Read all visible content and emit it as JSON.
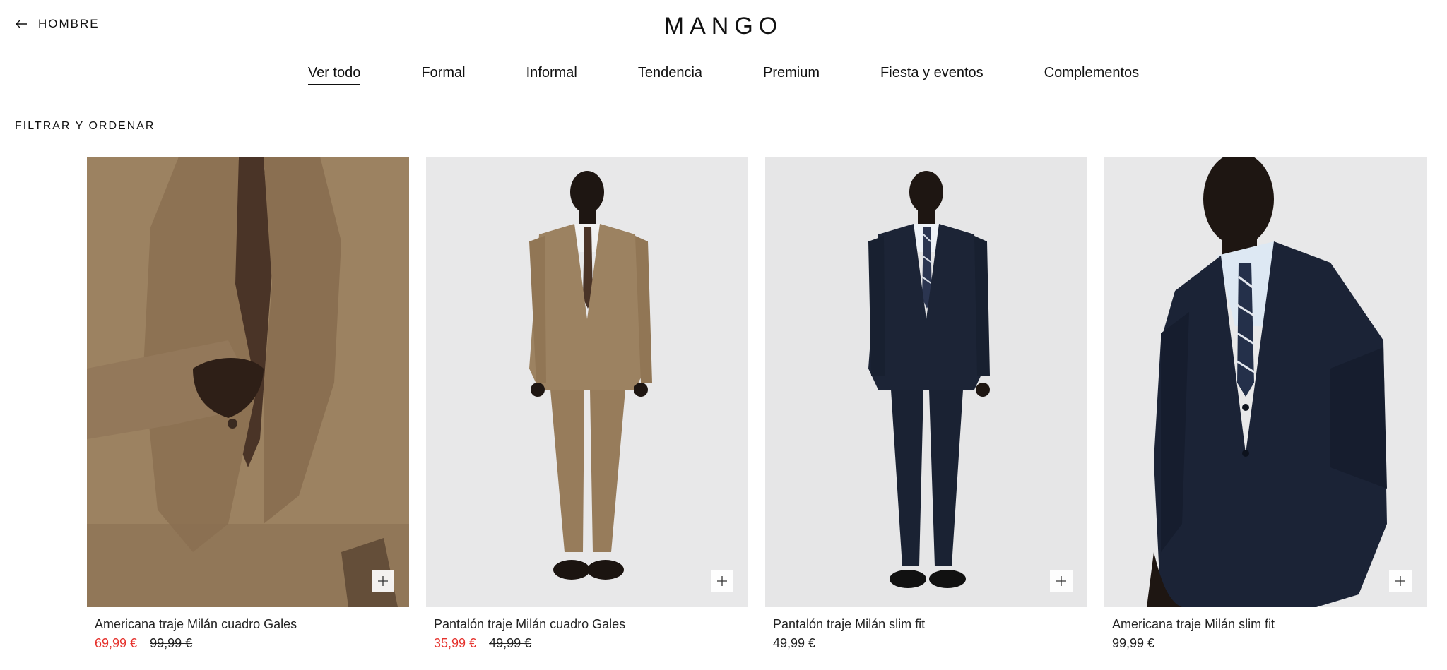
{
  "header": {
    "back_label": "HOMBRE",
    "logo": "MANGO"
  },
  "nav": {
    "items": [
      {
        "label": "Ver todo",
        "active": true
      },
      {
        "label": "Formal"
      },
      {
        "label": "Informal"
      },
      {
        "label": "Tendencia"
      },
      {
        "label": "Premium"
      },
      {
        "label": "Fiesta y eventos"
      },
      {
        "label": "Complementos"
      }
    ]
  },
  "filter_label": "FILTRAR Y ORDENAR",
  "products": [
    {
      "name": "Americana traje Milán cuadro Gales",
      "price": "69,99 €",
      "old_price": "99,99 €",
      "image": "brown-suit-closeup"
    },
    {
      "name": "Pantalón traje Milán cuadro Gales",
      "price": "35,99 €",
      "old_price": "49,99 €",
      "image": "brown-suit-full"
    },
    {
      "name": "Pantalón traje Milán slim fit",
      "price": "49,99 €",
      "image": "navy-suit-full"
    },
    {
      "name": "Americana traje Milán slim fit",
      "price": "99,99 €",
      "image": "navy-suit-half"
    }
  ],
  "colors": {
    "sale": "#e5322d",
    "brown_suit": "#9b7f5c",
    "navy_suit": "#1c2436",
    "image_bg": "#e9e9ea"
  }
}
